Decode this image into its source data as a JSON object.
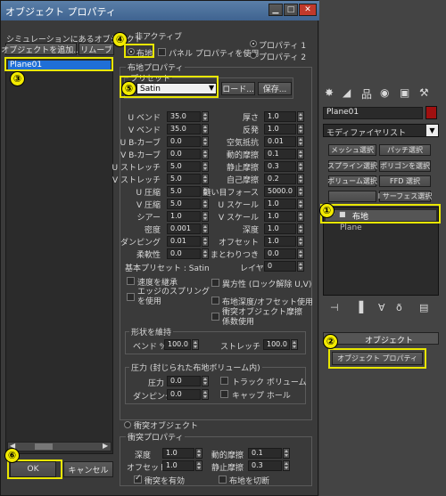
{
  "dialog": {
    "title": "オブジェクト プロパティ",
    "controls": {
      "minimize": "▁",
      "maximize": "□",
      "close": "✕"
    },
    "sim_objects_label": "シミュレーションにあるオブジェクト",
    "add_objects_label": "オブジェクトを追加...",
    "remove_label": "リムーブ",
    "list_items": [
      "Plane01"
    ],
    "inactive_label": "非アクティブ",
    "cloth_label": "布地",
    "use_panel_props_label": "パネル プロパティを使用",
    "property1_label": "プロパティ 1",
    "property2_label": "プロパティ 2",
    "cloth_props_title": "布地プロパティ",
    "preset_label": "プリセット",
    "preset_value": "Satin",
    "load_label": "ロード...",
    "save_label": "保存...",
    "left_params": [
      {
        "label": "U ベンド",
        "value": "35.0"
      },
      {
        "label": "V ベンド",
        "value": "35.0"
      },
      {
        "label": "U B-カーブ",
        "value": "0.0"
      },
      {
        "label": "V B-カーブ",
        "value": "0.0"
      },
      {
        "label": "U ストレッチ",
        "value": "5.0"
      },
      {
        "label": "V ストレッチ",
        "value": "5.0"
      },
      {
        "label": "U 圧縮",
        "value": "5.0"
      },
      {
        "label": "V 圧縮",
        "value": "5.0"
      },
      {
        "label": "シアー",
        "value": "1.0"
      },
      {
        "label": "密度",
        "value": "0.001"
      },
      {
        "label": "ダンピング",
        "value": "0.01"
      },
      {
        "label": "柔軟性",
        "value": "0.0"
      }
    ],
    "right_params": [
      {
        "label": "厚さ",
        "value": "1.0"
      },
      {
        "label": "反発",
        "value": "1.0"
      },
      {
        "label": "空気抵抗",
        "value": "0.01"
      },
      {
        "label": "動的摩擦",
        "value": "0.1"
      },
      {
        "label": "静止摩擦",
        "value": "0.3"
      },
      {
        "label": "自己摩擦",
        "value": "0.2"
      },
      {
        "label": "縫い目フォース",
        "value": "5000.0"
      },
      {
        "label": "U スケール",
        "value": "1.0"
      },
      {
        "label": "V スケール",
        "value": "1.0"
      },
      {
        "label": "深度",
        "value": "1.0"
      },
      {
        "label": "オフセット",
        "value": "1.0"
      },
      {
        "label": "まとわりつき",
        "value": "0.0"
      }
    ],
    "base_preset_label": "基本プリセット : Satin",
    "layer_label": "レイヤ",
    "layer_value": "0",
    "inherit_velocity_label": "速度を継承",
    "use_edge_springs_label": "エッジのスプリング\nを使用",
    "anisotropic_label": "異方性 (ロック解除 U,V)",
    "cloth_depth_offset_label": "布地深度/オフセット使用",
    "use_collision_friction_label": "衝突オブジェクト摩擦\n係数使用",
    "keep_shape_title": "形状を維持",
    "bend_pct_label": "ベンド %",
    "bend_pct_value": "100.0",
    "stretch_pct_label": "ストレッチ %",
    "stretch_pct_value": "100.0",
    "pressure_title": "圧力 (封じられた布地ボリューム内)",
    "pressure_label": "圧力",
    "pressure_value": "0.0",
    "damping_label": "ダンピング",
    "damping_value": "0.0",
    "track_volume_label": "トラック ボリューム",
    "cap_hole_label": "キャップ ホール",
    "collision_object_label": "衝突オブジェクト",
    "collision_props_title": "衝突プロパティ",
    "c_depth_label": "深度",
    "c_depth_value": "1.0",
    "c_offset_label": "オフセット",
    "c_offset_value": "1.0",
    "c_dyn_label": "動的摩擦",
    "c_dyn_value": "0.1",
    "c_static_label": "静止摩擦",
    "c_static_value": "0.3",
    "enable_collision_label": "衝突を有効",
    "cut_cloth_label": "布地を切断",
    "ok_label": "OK",
    "cancel_label": "キャンセル"
  },
  "command_panel": {
    "object_name": "Plane01",
    "modifier_list": "モディファイヤリスト",
    "buttons": [
      "メッシュ選択",
      "パッチ選択",
      "スプライン選択",
      "ポリゴンを選択",
      "ボリューム選択",
      "FFD 選択",
      "",
      "I サーフェス選択"
    ],
    "stack_items": [
      "布地",
      "Plane"
    ],
    "object_section": "オブジェクト",
    "object_props_button": "オブジェクト プロパティ"
  },
  "badges": [
    "①",
    "②",
    "③",
    "④",
    "⑤",
    "⑥"
  ],
  "colors": {
    "highlight": "#e8e600",
    "selection": "#1f6fd6",
    "color_swatch": "#a01010"
  }
}
